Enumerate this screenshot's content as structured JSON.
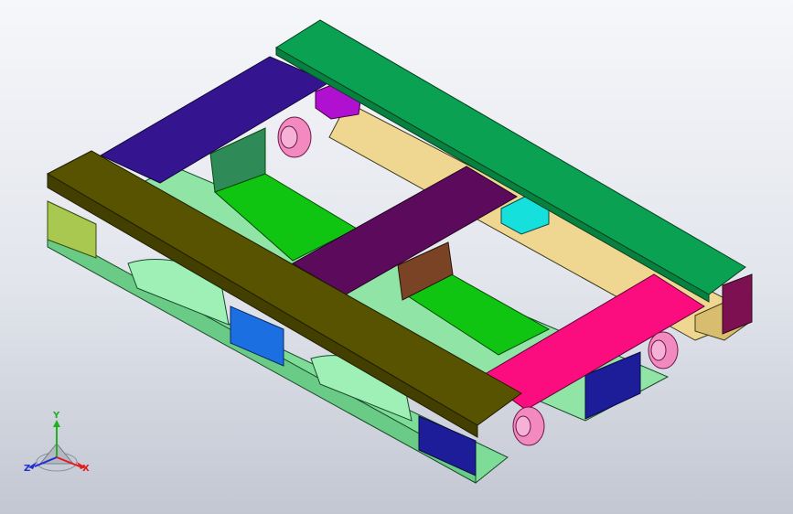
{
  "viewport": {
    "background_top": "#f6f7fa",
    "background_bottom": "#c3c7d2"
  },
  "model": {
    "part_colors": {
      "top_board_front": "#575300",
      "top_board_back": "#0ba153",
      "top_board_left": "#35158f",
      "top_board_right": "#fb0d7f",
      "center_stringer": "#5c0a5c",
      "bottom_skid": "#7ddc98",
      "green_recess": "#10c412",
      "tan_rail": "#efd792",
      "cyan_block": "#16e0dc",
      "blue_block": "#1c6fe0",
      "navy_block": "#1d1d9a",
      "brown_block": "#7a4325",
      "maroon_block": "#7d1050",
      "caster_wheel": "#f28ac0"
    }
  },
  "triad": {
    "x_label": "X",
    "y_label": "Y",
    "z_label": "Z",
    "x_color": "#e02020",
    "y_color": "#20b020",
    "z_color": "#2030d0"
  }
}
